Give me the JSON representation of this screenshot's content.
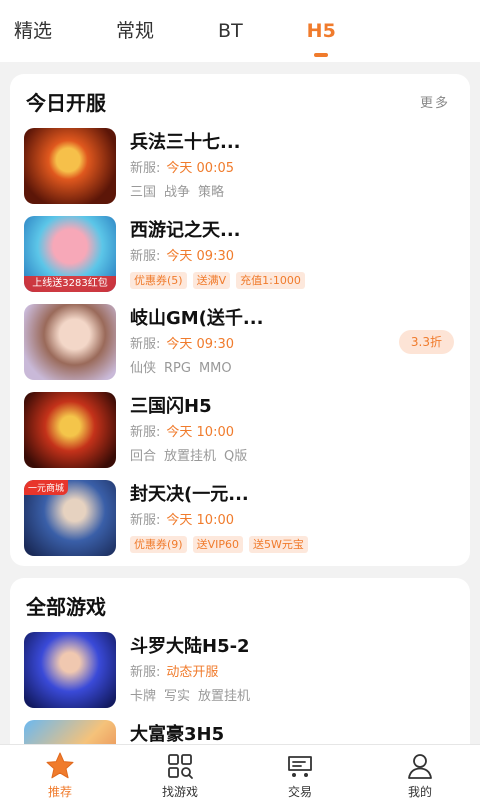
{
  "tabs": [
    {
      "label": "精选",
      "active": false
    },
    {
      "label": "常规",
      "active": false
    },
    {
      "label": "BT",
      "active": false
    },
    {
      "label": "H5",
      "active": true
    }
  ],
  "today": {
    "title": "今日开服",
    "more": "更多",
    "games": [
      {
        "name": "兵法三十七...",
        "server_label": "新服:",
        "server_time": "今天 00:05",
        "tags": [
          "三国",
          "战争",
          "策略"
        ],
        "promos": []
      },
      {
        "name": "西游记之天...",
        "server_label": "新服:",
        "server_time": "今天 09:30",
        "tags": [],
        "promos": [
          "优惠券(5)",
          "送满V",
          "充值1:1000"
        ],
        "icon_text": "上线送3283红包"
      },
      {
        "name": "岐山GM(送千...",
        "server_label": "新服:",
        "server_time": "今天 09:30",
        "tags": [
          "仙侠",
          "RPG",
          "MMO"
        ],
        "promos": [],
        "discount": "3.3折"
      },
      {
        "name": "三国闪H5",
        "server_label": "新服:",
        "server_time": "今天 10:00",
        "tags": [
          "回合",
          "放置挂机",
          "Q版"
        ],
        "promos": []
      },
      {
        "name": "封天决(一元...",
        "server_label": "新服:",
        "server_time": "今天 10:00",
        "tags": [],
        "promos": [
          "优惠券(9)",
          "送VIP60",
          "送5W元宝"
        ],
        "icon_badge": "一元商城"
      }
    ]
  },
  "all_games": {
    "title": "全部游戏",
    "games": [
      {
        "name": "斗罗大陆H5-2",
        "server_label": "新服:",
        "server_time": "动态开服",
        "tags": [
          "卡牌",
          "写实",
          "放置挂机"
        ]
      },
      {
        "name": "大富豪3H5"
      }
    ]
  },
  "nav": [
    {
      "label": "推荐",
      "icon": "star-icon",
      "active": true
    },
    {
      "label": "找游戏",
      "icon": "grid-search-icon",
      "active": false
    },
    {
      "label": "交易",
      "icon": "trade-cart-icon",
      "active": false
    },
    {
      "label": "我的",
      "icon": "user-icon",
      "active": false
    }
  ],
  "colors": {
    "accent": "#f07b2c",
    "promo_bg": "#fde8dc"
  }
}
